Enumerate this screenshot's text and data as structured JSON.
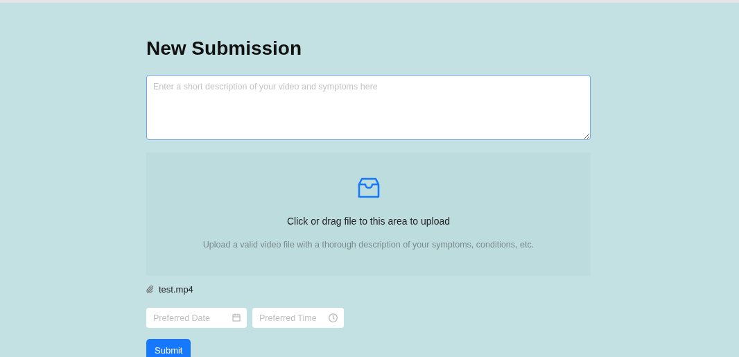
{
  "title": "New Submission",
  "description": {
    "placeholder": "Enter a short description of your video and symptoms here"
  },
  "upload": {
    "title": "Click or drag file to this area to upload",
    "hint": "Upload a valid video file with a thorough description of your symptoms, conditions, etc."
  },
  "files": [
    {
      "name": "test.mp4"
    }
  ],
  "date_field": {
    "placeholder": "Preferred Date"
  },
  "time_field": {
    "placeholder": "Preferred Time"
  },
  "submit": {
    "label": "Submit"
  }
}
